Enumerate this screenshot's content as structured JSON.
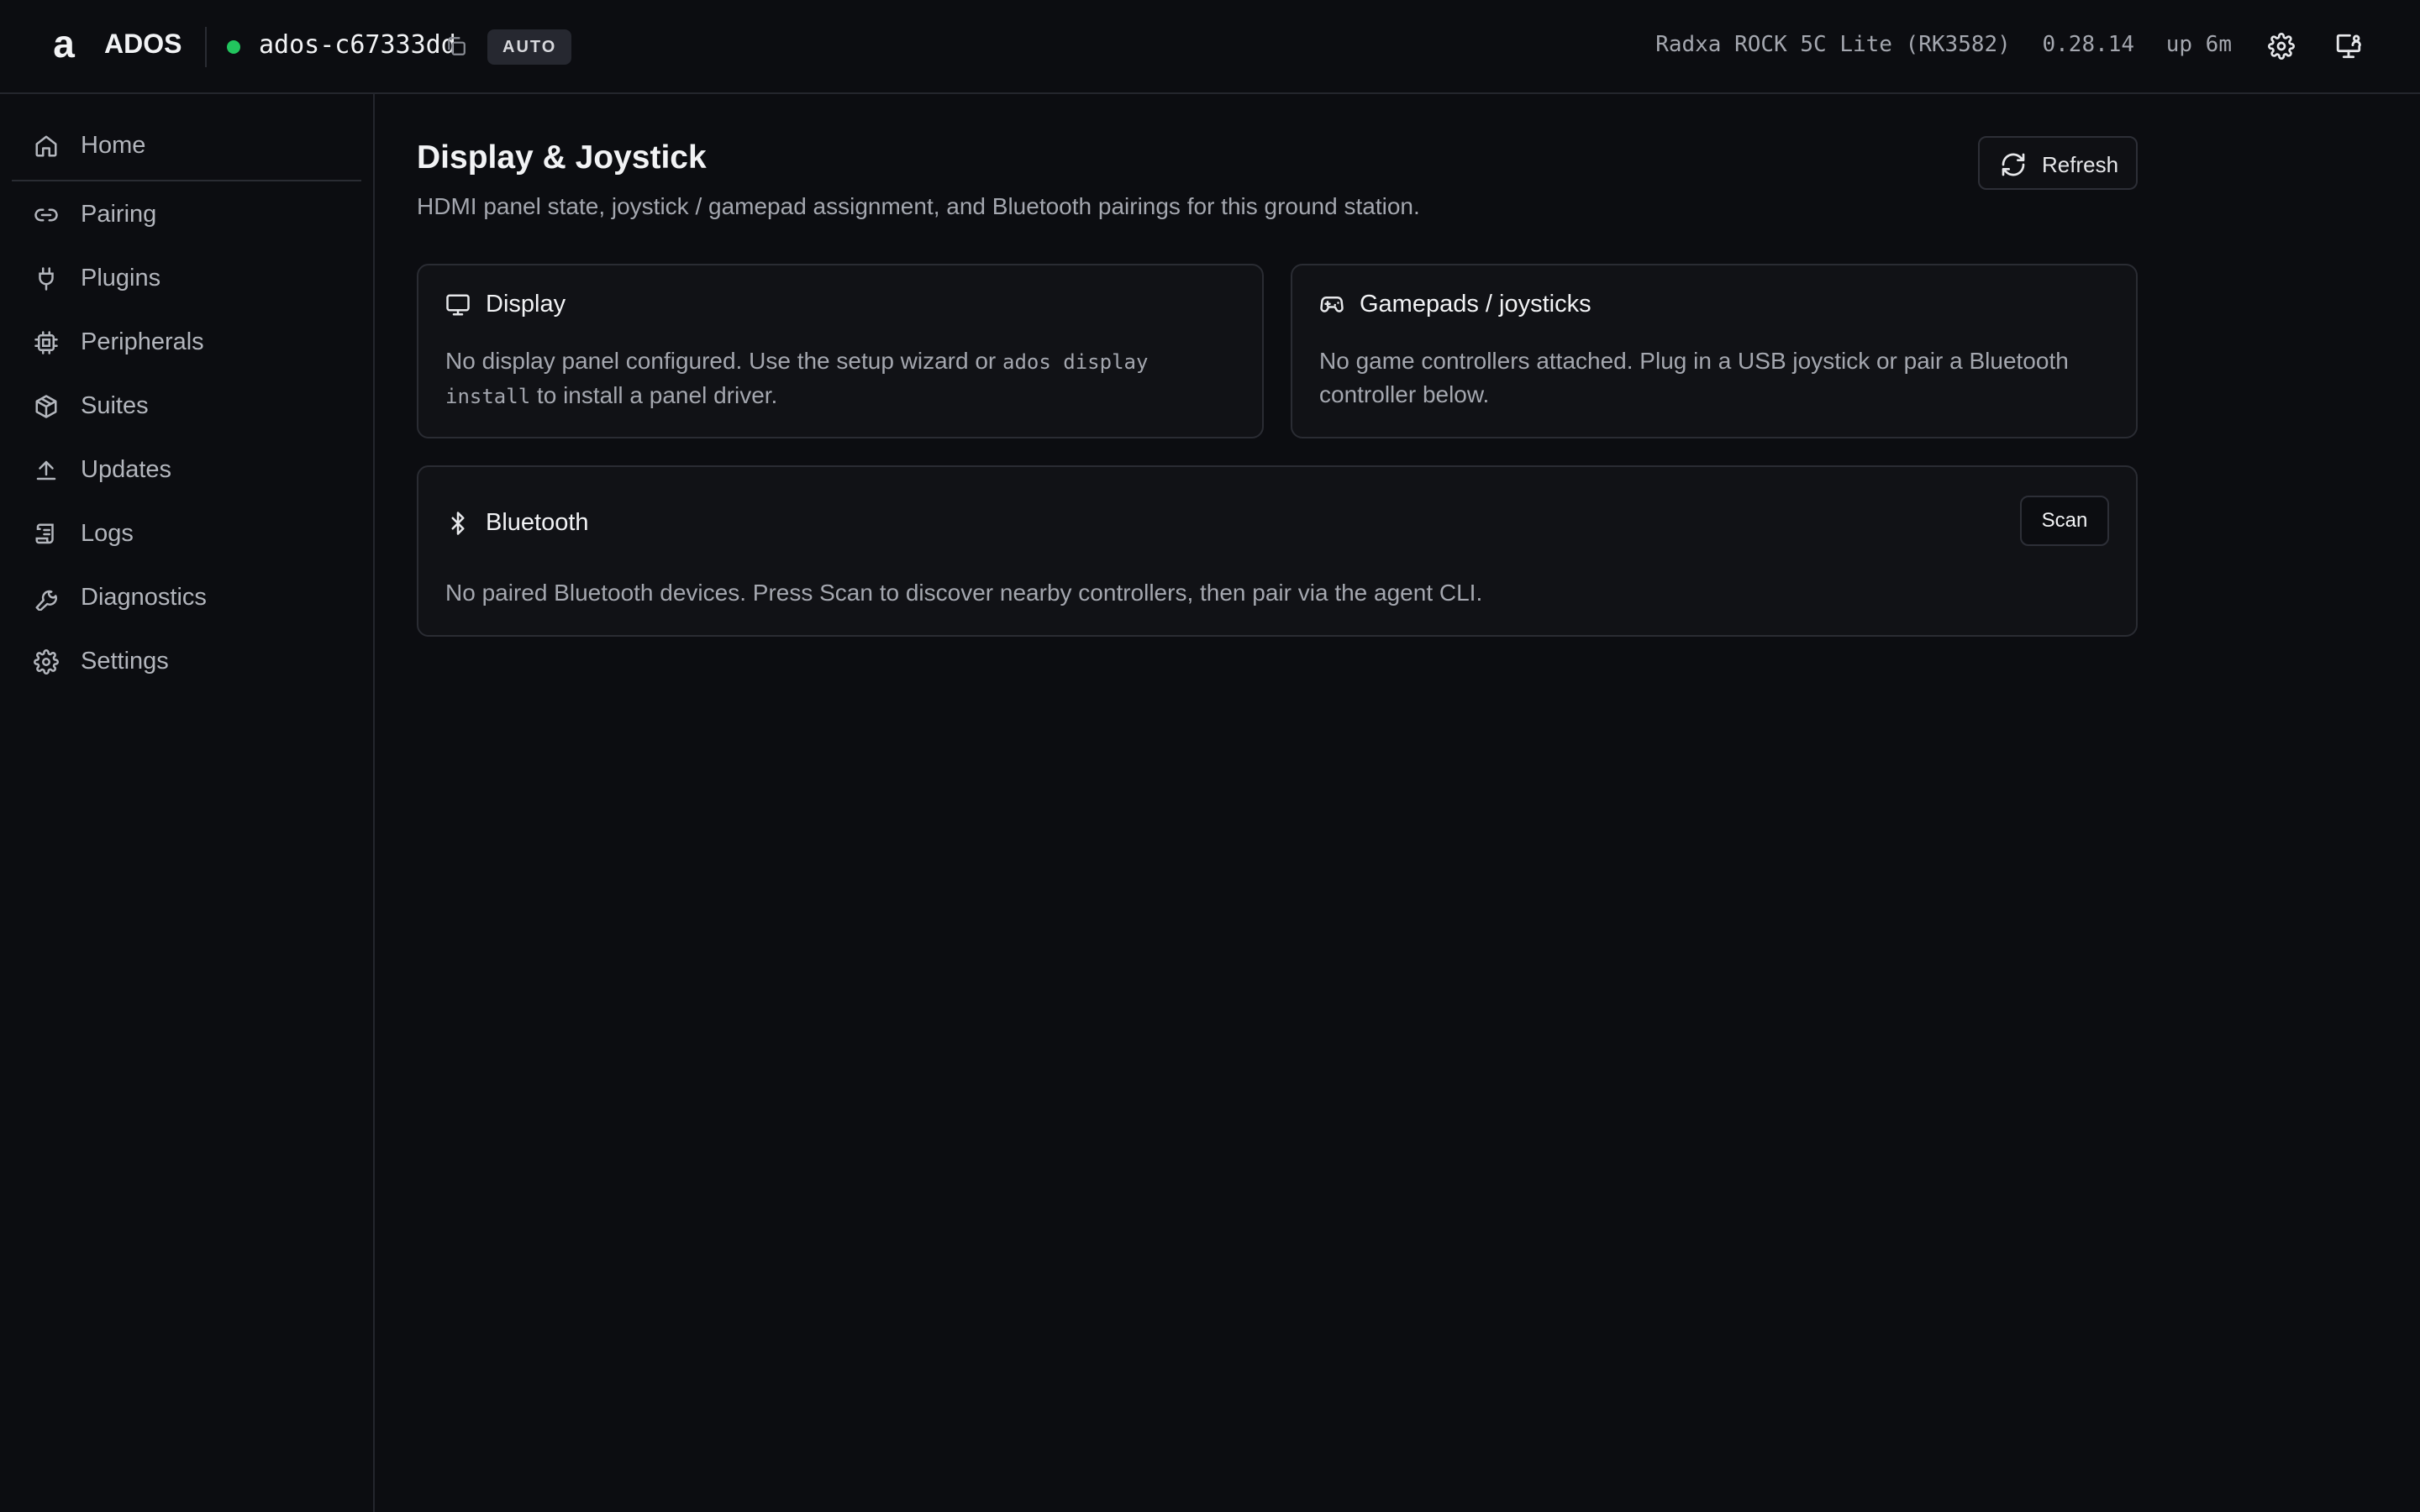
{
  "topbar": {
    "brand": "ADOS",
    "hostname": "ados-c67333dd",
    "mode_badge": "AUTO",
    "device": "Radxa ROCK 5C Lite (RK3582)",
    "version": "0.28.14",
    "uptime": "up 6m",
    "status_color": "#22c55e",
    "icons": [
      "copy-icon",
      "settings-gear-icon",
      "monitor-user-icon"
    ]
  },
  "sidebar": {
    "items": [
      {
        "label": "Home",
        "icon": "home-icon"
      },
      {
        "label": "Pairing",
        "icon": "link-icon"
      },
      {
        "label": "Plugins",
        "icon": "plug-icon"
      },
      {
        "label": "Peripherals",
        "icon": "cpu-chip-icon"
      },
      {
        "label": "Suites",
        "icon": "package-icon"
      },
      {
        "label": "Updates",
        "icon": "upload-icon"
      },
      {
        "label": "Logs",
        "icon": "scroll-icon"
      },
      {
        "label": "Diagnostics",
        "icon": "wrench-icon"
      },
      {
        "label": "Settings",
        "icon": "gear-icon"
      }
    ]
  },
  "main": {
    "title": "Display & Joystick",
    "subtitle": "HDMI panel state, joystick / gamepad assignment, and Bluetooth pairings for this ground station.",
    "refresh_label": "Refresh",
    "display_card": {
      "title": "Display",
      "body_before": "No display panel configured. Use the setup wizard or ",
      "body_code": "ados display install",
      "body_after": " to install a panel driver."
    },
    "gamepads_card": {
      "title": "Gamepads / joysticks",
      "body": "No game controllers attached. Plug in a USB joystick or pair a Bluetooth controller below."
    },
    "bluetooth_card": {
      "title": "Bluetooth",
      "scan_label": "Scan",
      "body": "No paired Bluetooth devices. Press Scan to discover nearby controllers, then pair via the agent CLI."
    }
  }
}
